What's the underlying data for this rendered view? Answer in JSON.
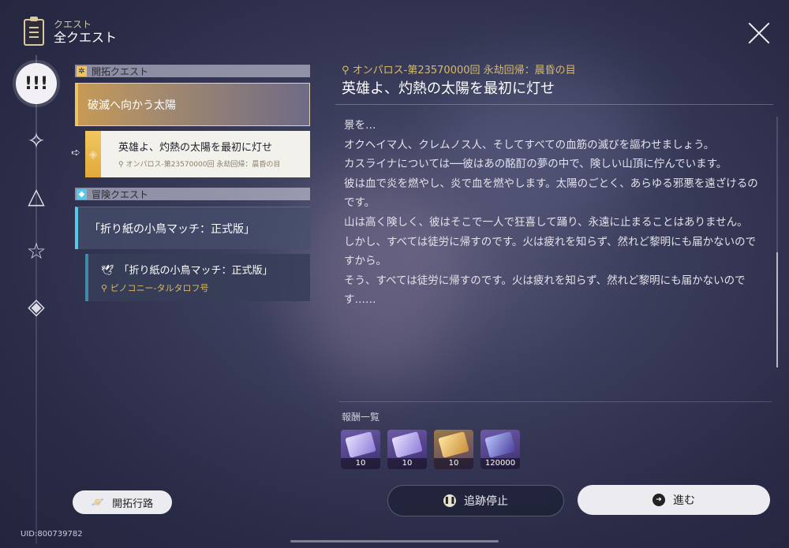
{
  "header": {
    "subtitle": "クエスト",
    "title": "全クエスト"
  },
  "sections": {
    "trailblaze": {
      "label": "開拓クエスト",
      "chapter": "破滅へ向かう太陽",
      "quest": {
        "title": "英雄よ、灼熱の太陽を最初に灯せ",
        "location": "オンパロス-第23570000回 永劫回帰：晨昏の目"
      }
    },
    "adventure": {
      "label": "冒険クエスト",
      "chapter": "「折り紙の小鳥マッチ：正式版」",
      "quest": {
        "title": "「折り紙の小鳥マッチ：正式版」",
        "location": "ピノコニー-タルタロフ号"
      }
    }
  },
  "detail": {
    "location": "オンパロス-第23570000回 永劫回帰：晨昏の目",
    "title": "英雄よ、灼熱の太陽を最初に灯せ",
    "lines": [
      "景を…",
      "オクヘイマ人、クレムノス人、そしてすべての血筋の滅びを謳わせましょう。",
      "カスライナについては──彼はあの酩酊の夢の中で、険しい山頂に佇んでいます。",
      "彼は血で炎を燃やし、炎で血を燃やします。太陽のごとく、あらゆる邪悪を遠ざけるのです。",
      "山は高く険しく、彼はそこで一人で狂喜して踊り、永遠に止まることはありません。",
      "しかし、すべては徒労に帰すのです。火は疲れを知らず、然れど黎明にも届かないのですから。",
      "そう、すべては徒労に帰すのです。火は疲れを知らず、然れど黎明にも届かないのです……"
    ]
  },
  "rewards": {
    "label": "報酬一覧",
    "items": [
      {
        "icon": "relic-crystal-icon",
        "count": "10"
      },
      {
        "icon": "light-cone-material-icon",
        "count": "10"
      },
      {
        "icon": "gold-book-icon",
        "count": "10"
      },
      {
        "icon": "credit-ticket-icon",
        "count": "120000"
      }
    ]
  },
  "buttons": {
    "route": "開拓行路",
    "stop_tracking": "追跡停止",
    "proceed": "進む"
  },
  "uid": "UID:800739782",
  "colors": {
    "trailblaze_accent": "#f0c35f",
    "adventure_accent": "#56c8e8",
    "location_gold": "#d8b96a"
  }
}
